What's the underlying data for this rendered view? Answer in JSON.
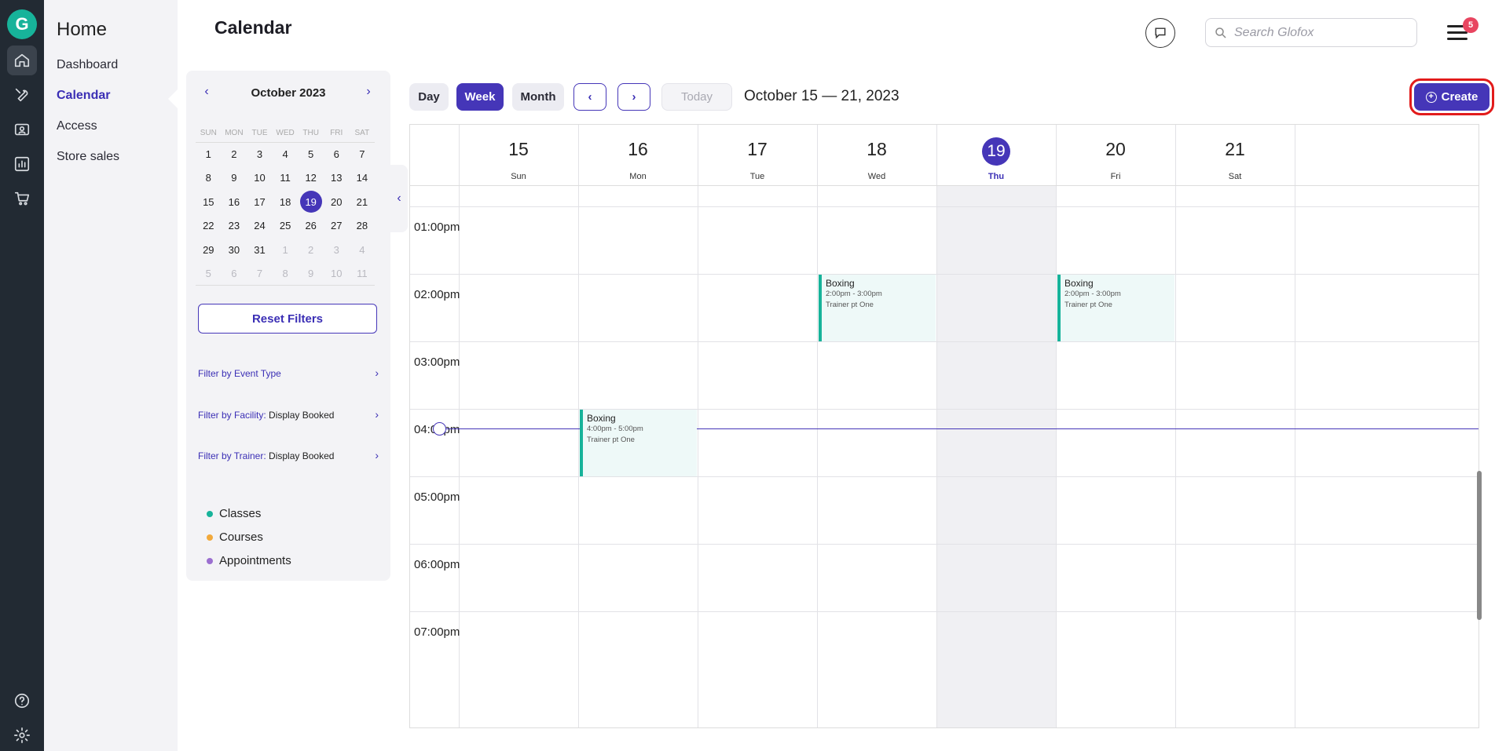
{
  "nav": {
    "home_title": "Home",
    "items": [
      {
        "label": "Dashboard",
        "active": false
      },
      {
        "label": "Calendar",
        "active": true
      },
      {
        "label": "Access",
        "active": false
      },
      {
        "label": "Store sales",
        "active": false
      }
    ]
  },
  "rail_icons": [
    "home-icon",
    "wrench-icon",
    "user-card-icon",
    "bar-chart-icon",
    "cart-icon",
    "help-icon",
    "gear-icon"
  ],
  "header": {
    "title": "Calendar",
    "search_placeholder": "Search Glofox",
    "notification_count": "5"
  },
  "mini_calendar": {
    "month": "October 2023",
    "dow": [
      "SUN",
      "MON",
      "TUE",
      "WED",
      "THU",
      "FRI",
      "SAT"
    ],
    "weeks": [
      [
        "1",
        "2",
        "3",
        "4",
        "5",
        "6",
        "7"
      ],
      [
        "8",
        "9",
        "10",
        "11",
        "12",
        "13",
        "14"
      ],
      [
        "15",
        "16",
        "17",
        "18",
        "19",
        "20",
        "21"
      ],
      [
        "22",
        "23",
        "24",
        "25",
        "26",
        "27",
        "28"
      ],
      [
        "29",
        "30",
        "31",
        "1",
        "2",
        "3",
        "4"
      ],
      [
        "5",
        "6",
        "7",
        "8",
        "9",
        "10",
        "11"
      ]
    ],
    "selected": "19"
  },
  "filters": {
    "reset_label": "Reset Filters",
    "event_type_key": "Filter by Event Type",
    "facility_key": "Filter by Facility:",
    "facility_value": "Display Booked",
    "trainer_key": "Filter by Trainer:",
    "trainer_value": "Display Booked"
  },
  "legend": [
    {
      "label": "Classes",
      "color": "#17b39a"
    },
    {
      "label": "Courses",
      "color": "#f2a93b"
    },
    {
      "label": "Appointments",
      "color": "#9b6fd0"
    }
  ],
  "toolbar": {
    "day": "Day",
    "week": "Week",
    "month": "Month",
    "today": "Today",
    "range": "October 15 — 21, 2023",
    "create": "Create"
  },
  "week": {
    "days": [
      {
        "num": "15",
        "name": "Sun"
      },
      {
        "num": "16",
        "name": "Mon"
      },
      {
        "num": "17",
        "name": "Tue"
      },
      {
        "num": "18",
        "name": "Wed"
      },
      {
        "num": "19",
        "name": "Thu",
        "today": true
      },
      {
        "num": "20",
        "name": "Fri"
      },
      {
        "num": "21",
        "name": "Sat"
      }
    ],
    "hours": [
      "01:00pm",
      "02:00pm",
      "03:00pm",
      "04:00pm",
      "05:00pm",
      "06:00pm",
      "07:00pm"
    ]
  },
  "events": [
    {
      "name": "Boxing",
      "time": "2:00pm - 3:00pm",
      "trainer": "Trainer pt One",
      "day": "18"
    },
    {
      "name": "Boxing",
      "time": "2:00pm - 3:00pm",
      "trainer": "Trainer pt One",
      "day": "20"
    },
    {
      "name": "Boxing",
      "time": "4:00pm - 5:00pm",
      "trainer": "Trainer pt One",
      "day": "16"
    }
  ]
}
